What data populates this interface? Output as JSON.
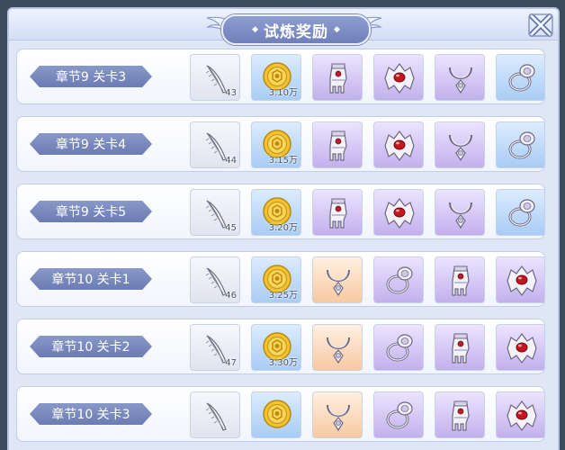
{
  "window": {
    "title": "试炼奖励"
  },
  "icons": {
    "close": "close-x-icon",
    "wing": "wing-ornament-icon"
  },
  "colors": {
    "grey": "#e0e4ef",
    "blue": "#a8ccf4",
    "purple": "#c2b0ec",
    "orange": "#f7c9a1",
    "label": "#7585bd"
  },
  "rows": [
    {
      "label": "章节9 关卡3",
      "items": [
        {
          "icon": "feather-icon",
          "quality": "grey",
          "count": "43"
        },
        {
          "icon": "gold-coin-icon",
          "quality": "blue",
          "count": "3.10万"
        },
        {
          "icon": "glove-icon",
          "quality": "purple",
          "count": ""
        },
        {
          "icon": "red-gem-shell-icon",
          "quality": "purple",
          "count": ""
        },
        {
          "icon": "necklace-icon",
          "quality": "purple",
          "count": ""
        },
        {
          "icon": "ring-icon",
          "quality": "blue",
          "count": ""
        }
      ]
    },
    {
      "label": "章节9 关卡4",
      "items": [
        {
          "icon": "feather-icon",
          "quality": "grey",
          "count": "44"
        },
        {
          "icon": "gold-coin-icon",
          "quality": "blue",
          "count": "3.15万"
        },
        {
          "icon": "glove-icon",
          "quality": "purple",
          "count": ""
        },
        {
          "icon": "red-gem-shell-icon",
          "quality": "purple",
          "count": ""
        },
        {
          "icon": "necklace-icon",
          "quality": "purple",
          "count": ""
        },
        {
          "icon": "ring-icon",
          "quality": "blue",
          "count": ""
        }
      ]
    },
    {
      "label": "章节9 关卡5",
      "items": [
        {
          "icon": "feather-icon",
          "quality": "grey",
          "count": "45"
        },
        {
          "icon": "gold-coin-icon",
          "quality": "blue",
          "count": "3.20万"
        },
        {
          "icon": "glove-icon",
          "quality": "purple",
          "count": ""
        },
        {
          "icon": "red-gem-shell-icon",
          "quality": "purple",
          "count": ""
        },
        {
          "icon": "necklace-icon",
          "quality": "purple",
          "count": ""
        },
        {
          "icon": "ring-icon",
          "quality": "blue",
          "count": ""
        }
      ]
    },
    {
      "label": "章节10 关卡1",
      "items": [
        {
          "icon": "feather-icon",
          "quality": "grey",
          "count": "46"
        },
        {
          "icon": "gold-coin-icon",
          "quality": "blue",
          "count": "3.25万"
        },
        {
          "icon": "necklace-icon",
          "quality": "orange",
          "count": ""
        },
        {
          "icon": "ring-icon",
          "quality": "purple",
          "count": ""
        },
        {
          "icon": "glove-icon",
          "quality": "purple",
          "count": ""
        },
        {
          "icon": "red-gem-shell-icon",
          "quality": "purple",
          "count": ""
        }
      ]
    },
    {
      "label": "章节10 关卡2",
      "items": [
        {
          "icon": "feather-icon",
          "quality": "grey",
          "count": "47"
        },
        {
          "icon": "gold-coin-icon",
          "quality": "blue",
          "count": "3.30万"
        },
        {
          "icon": "necklace-icon",
          "quality": "orange",
          "count": ""
        },
        {
          "icon": "ring-icon",
          "quality": "purple",
          "count": ""
        },
        {
          "icon": "glove-icon",
          "quality": "purple",
          "count": ""
        },
        {
          "icon": "red-gem-shell-icon",
          "quality": "purple",
          "count": ""
        }
      ]
    },
    {
      "label": "章节10 关卡3",
      "items": [
        {
          "icon": "feather-icon",
          "quality": "grey",
          "count": ""
        },
        {
          "icon": "gold-coin-icon",
          "quality": "blue",
          "count": ""
        },
        {
          "icon": "necklace-icon",
          "quality": "orange",
          "count": ""
        },
        {
          "icon": "ring-icon",
          "quality": "purple",
          "count": ""
        },
        {
          "icon": "glove-icon",
          "quality": "purple",
          "count": ""
        },
        {
          "icon": "red-gem-shell-icon",
          "quality": "purple",
          "count": ""
        }
      ]
    }
  ]
}
